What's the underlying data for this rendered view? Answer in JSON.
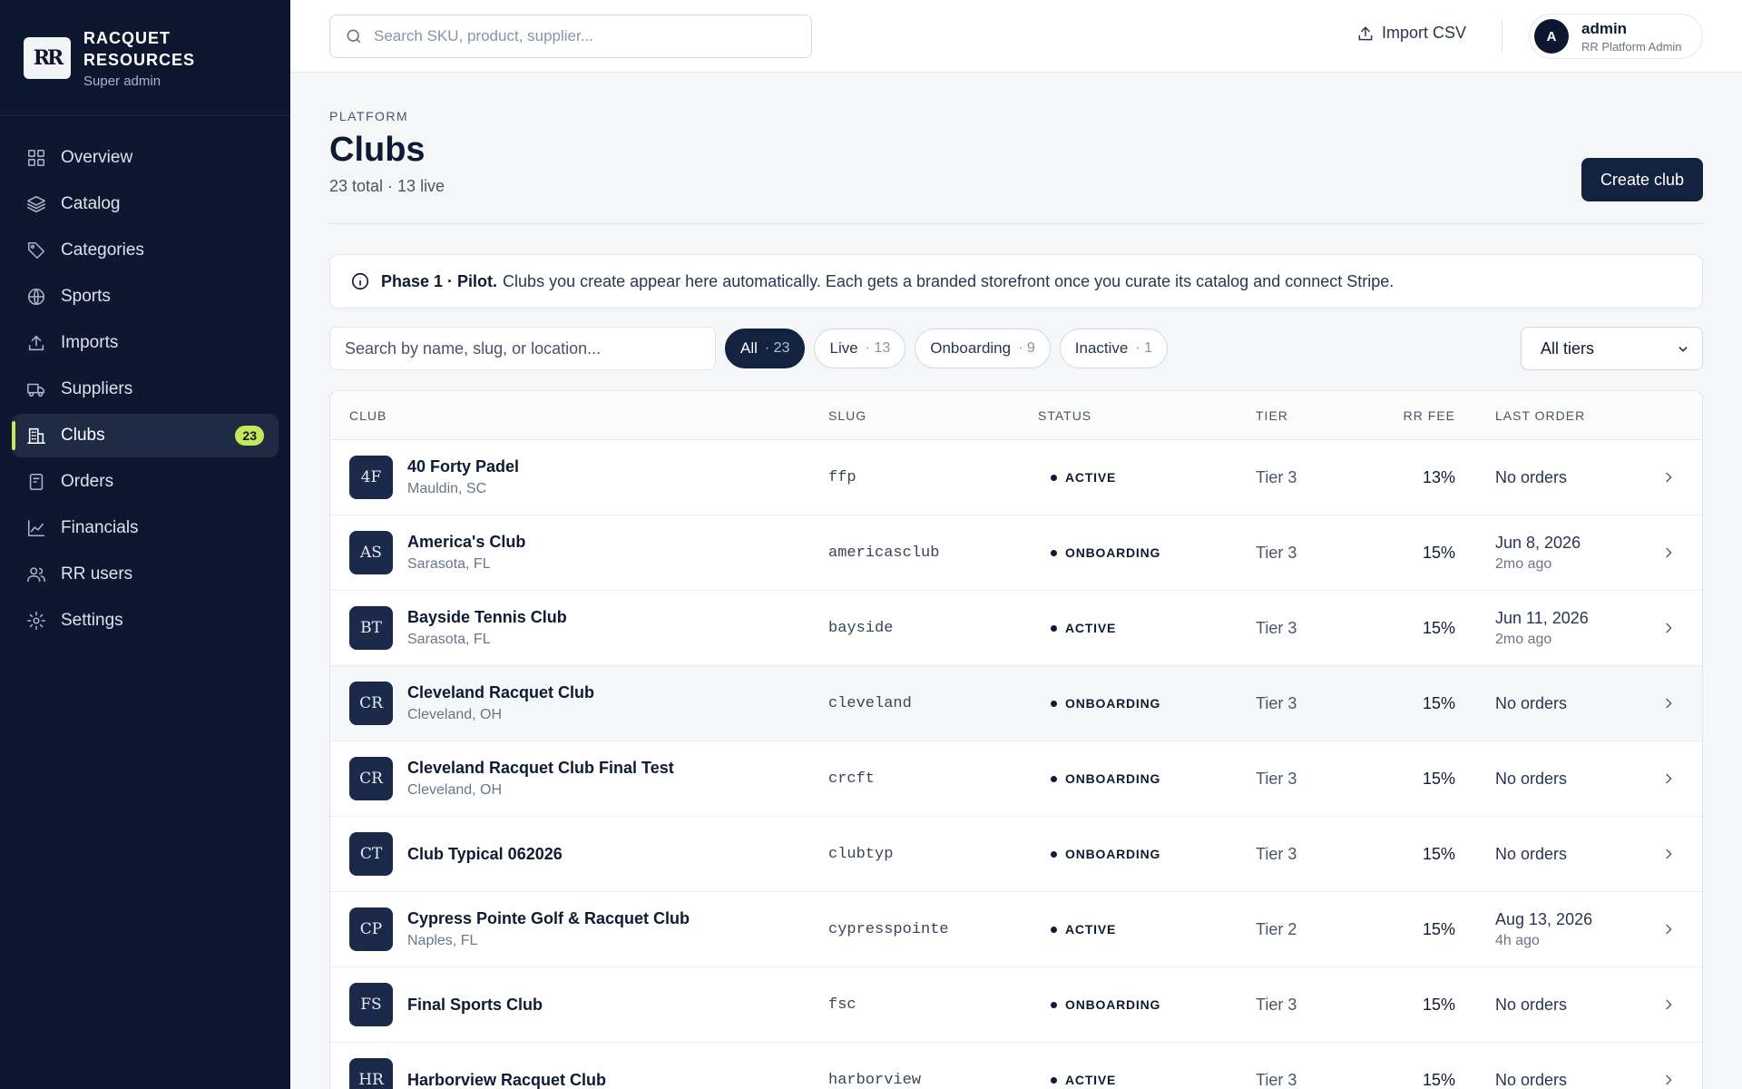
{
  "brand": {
    "logo": "RR",
    "name_line1": "RACQUET",
    "name_line2": "RESOURCES",
    "subtitle": "Super admin"
  },
  "nav": [
    {
      "label": "Overview",
      "icon": "grid-icon"
    },
    {
      "label": "Catalog",
      "icon": "layers-icon"
    },
    {
      "label": "Categories",
      "icon": "tag-icon"
    },
    {
      "label": "Sports",
      "icon": "globe-icon"
    },
    {
      "label": "Imports",
      "icon": "upload-icon"
    },
    {
      "label": "Suppliers",
      "icon": "truck-icon"
    },
    {
      "label": "Clubs",
      "icon": "building-icon",
      "badge": "23",
      "active": true
    },
    {
      "label": "Orders",
      "icon": "receipt-icon"
    },
    {
      "label": "Financials",
      "icon": "chart-icon"
    },
    {
      "label": "RR users",
      "icon": "users-icon"
    },
    {
      "label": "Settings",
      "icon": "gear-icon"
    }
  ],
  "topbar": {
    "search_placeholder": "Search SKU, product, supplier...",
    "import_label": "Import CSV",
    "account": {
      "initial": "A",
      "name": "admin",
      "role": "RR Platform Admin"
    }
  },
  "page": {
    "eyebrow": "PLATFORM",
    "title": "Clubs",
    "subtitle": "23 total · 13 live",
    "create_label": "Create club"
  },
  "notice": {
    "bold": "Phase 1 · Pilot.",
    "text": "Clubs you create appear here automatically. Each gets a branded storefront once you curate its catalog and connect Stripe."
  },
  "filters": {
    "search_placeholder": "Search by name, slug, or location...",
    "chips": [
      {
        "label": "All",
        "count": "· 23",
        "active": true
      },
      {
        "label": "Live",
        "count": "· 13"
      },
      {
        "label": "Onboarding",
        "count": "· 9"
      },
      {
        "label": "Inactive",
        "count": "· 1"
      }
    ],
    "tier_selected": "All tiers"
  },
  "table": {
    "headers": {
      "club": "CLUB",
      "slug": "SLUG",
      "status": "STATUS",
      "tier": "TIER",
      "fee": "RR FEE",
      "last": "LAST ORDER"
    },
    "rows": [
      {
        "mono": "4F",
        "name": "40 Forty Padel",
        "location": "Mauldin, SC",
        "slug": "ffp",
        "status": "ACTIVE",
        "tier": "Tier 3",
        "fee": "13%",
        "last": "No orders",
        "ago": ""
      },
      {
        "mono": "AS",
        "name": "America's Club",
        "location": "Sarasota, FL",
        "slug": "americasclub",
        "status": "ONBOARDING",
        "tier": "Tier 3",
        "fee": "15%",
        "last": "Jun 8, 2026",
        "ago": "2mo ago"
      },
      {
        "mono": "BT",
        "name": "Bayside Tennis Club",
        "location": "Sarasota, FL",
        "slug": "bayside",
        "status": "ACTIVE",
        "tier": "Tier 3",
        "fee": "15%",
        "last": "Jun 11, 2026",
        "ago": "2mo ago"
      },
      {
        "mono": "CR",
        "name": "Cleveland Racquet Club",
        "location": "Cleveland, OH",
        "slug": "cleveland",
        "status": "ONBOARDING",
        "tier": "Tier 3",
        "fee": "15%",
        "last": "No orders",
        "ago": "",
        "hover": true
      },
      {
        "mono": "CR",
        "name": "Cleveland Racquet Club Final Test",
        "location": "Cleveland, OH",
        "slug": "crcft",
        "status": "ONBOARDING",
        "tier": "Tier 3",
        "fee": "15%",
        "last": "No orders",
        "ago": ""
      },
      {
        "mono": "CT",
        "name": "Club Typical 062026",
        "location": "",
        "slug": "clubtyp",
        "status": "ONBOARDING",
        "tier": "Tier 3",
        "fee": "15%",
        "last": "No orders",
        "ago": ""
      },
      {
        "mono": "CP",
        "name": "Cypress Pointe Golf & Racquet Club",
        "location": "Naples, FL",
        "slug": "cypresspointe",
        "status": "ACTIVE",
        "tier": "Tier 2",
        "fee": "15%",
        "last": "Aug 13, 2026",
        "ago": "4h ago"
      },
      {
        "mono": "FS",
        "name": "Final Sports Club",
        "location": "",
        "slug": "fsc",
        "status": "ONBOARDING",
        "tier": "Tier 3",
        "fee": "15%",
        "last": "No orders",
        "ago": ""
      },
      {
        "mono": "HR",
        "name": "Harborview Racquet Club",
        "location": "",
        "slug": "harborview",
        "status": "ACTIVE",
        "tier": "Tier 3",
        "fee": "15%",
        "last": "No orders",
        "ago": ""
      }
    ]
  },
  "colors": {
    "sidebar_bg": "#0d1830",
    "accent": "#c8e65c",
    "primary_button": "#13223f"
  }
}
